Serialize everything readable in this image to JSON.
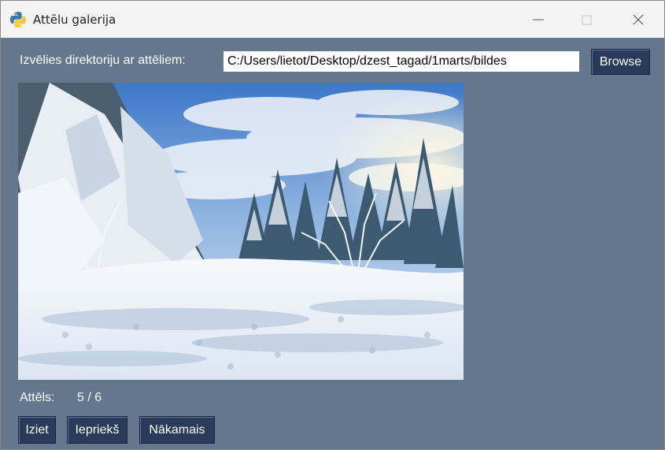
{
  "window": {
    "title": "Attēlu galerija",
    "app_icon": "python-icon",
    "controls": [
      "minimize-icon",
      "maximize-icon",
      "close-icon"
    ]
  },
  "directory": {
    "label": "Izvēlies direktoriju ar attēliem:",
    "path_value": "C:/Users/lietot/Desktop/dzest_tagad/1marts/bildes",
    "browse_label": "Browse"
  },
  "image": {
    "description_icon": "snowy-forest-photo"
  },
  "counter": {
    "label": "Attēls:",
    "value": "5 / 6"
  },
  "buttons": {
    "exit_label": "Iziet",
    "prev_label": "Iepriekš",
    "next_label": "Nākamais"
  },
  "colors": {
    "window_bg": "#64778d",
    "button_bg": "#283b5b",
    "titlebar_bg": "#f3f3f3"
  }
}
